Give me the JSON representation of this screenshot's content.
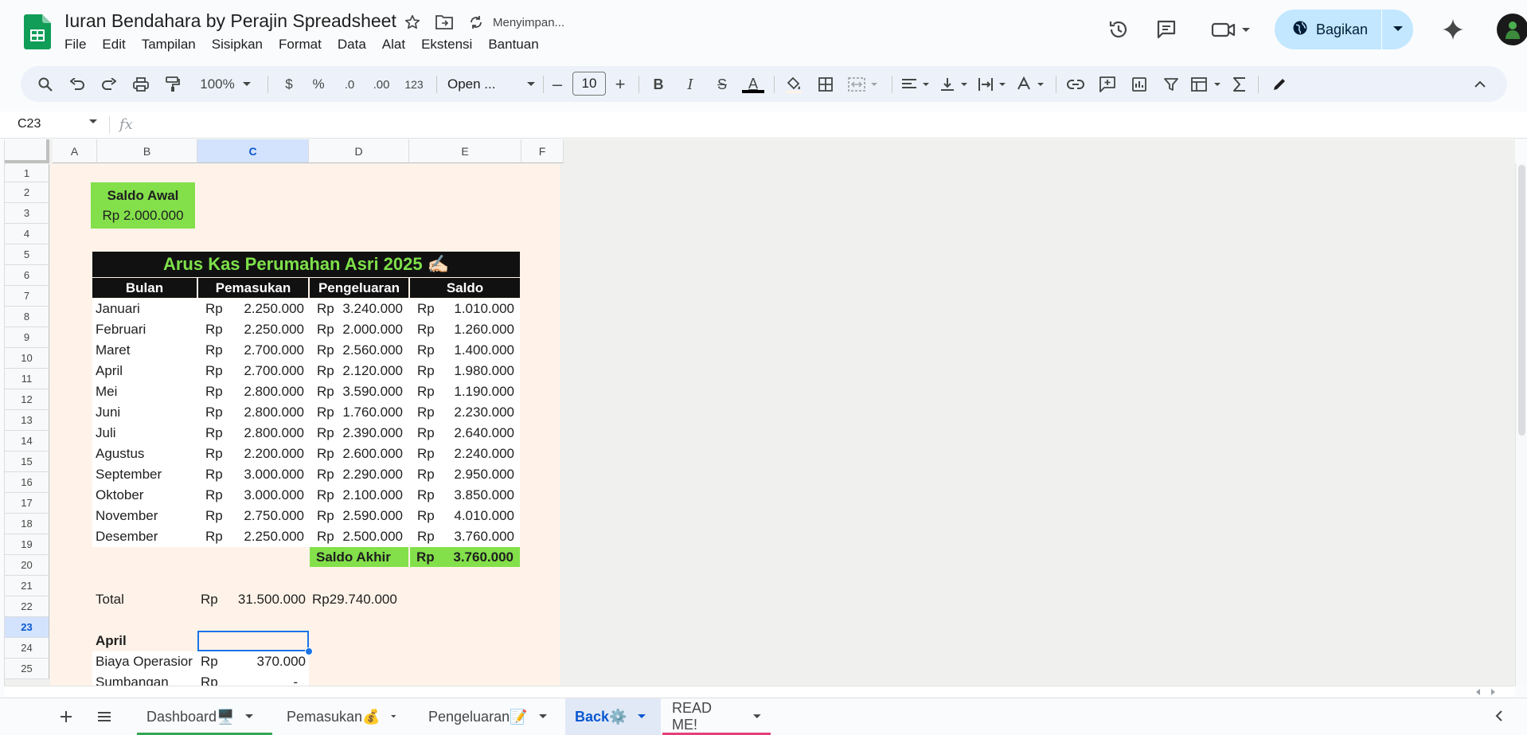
{
  "app": {
    "title": "Iuran Bendahara by Perajin Spreadsheet",
    "saving_status": "Menyimpan...",
    "menu": [
      "File",
      "Edit",
      "Tampilan",
      "Sisipkan",
      "Format",
      "Data",
      "Alat",
      "Ekstensi",
      "Bantuan"
    ],
    "share_label": "Bagikan"
  },
  "toolbar": {
    "zoom": "100%",
    "currency": "$",
    "percent": "%",
    "dec_decrease": ".0",
    "dec_increase": ".00",
    "number_format": "123",
    "font": "Open ...",
    "font_size": "10",
    "minus": "–",
    "plus": "+",
    "bold": "B",
    "italic": "I",
    "strike": "S",
    "text_color": "A"
  },
  "formula_bar": {
    "name_box": "C23",
    "fx": "fx"
  },
  "columns": [
    "A",
    "B",
    "C",
    "D",
    "E",
    "F"
  ],
  "rows": [
    "1",
    "2",
    "3",
    "4",
    "5",
    "6",
    "7",
    "8",
    "9",
    "10",
    "11",
    "12",
    "13",
    "14",
    "15",
    "16",
    "17",
    "18",
    "19",
    "20",
    "21",
    "22",
    "23",
    "24",
    "25"
  ],
  "sheet": {
    "saldo_awal_label": "Saldo Awal",
    "saldo_awal_value": "Rp  2.000.000",
    "table_title": "Arus Kas Perumahan Asri 2025",
    "table_title_emoji": "✍🏻",
    "headers": [
      "Bulan",
      "Pemasukan",
      "Pengeluaran",
      "Saldo"
    ],
    "currency": "Rp",
    "months": [
      {
        "bulan": "Januari",
        "masuk": "2.250.000",
        "keluar": "3.240.000",
        "saldo": "1.010.000"
      },
      {
        "bulan": "Februari",
        "masuk": "2.250.000",
        "keluar": "2.000.000",
        "saldo": "1.260.000"
      },
      {
        "bulan": "Maret",
        "masuk": "2.700.000",
        "keluar": "2.560.000",
        "saldo": "1.400.000"
      },
      {
        "bulan": "April",
        "masuk": "2.700.000",
        "keluar": "2.120.000",
        "saldo": "1.980.000"
      },
      {
        "bulan": "Mei",
        "masuk": "2.800.000",
        "keluar": "3.590.000",
        "saldo": "1.190.000"
      },
      {
        "bulan": "Juni",
        "masuk": "2.800.000",
        "keluar": "1.760.000",
        "saldo": "2.230.000"
      },
      {
        "bulan": "Juli",
        "masuk": "2.800.000",
        "keluar": "2.390.000",
        "saldo": "2.640.000"
      },
      {
        "bulan": "Agustus",
        "masuk": "2.200.000",
        "keluar": "2.600.000",
        "saldo": "2.240.000"
      },
      {
        "bulan": "September",
        "masuk": "3.000.000",
        "keluar": "2.290.000",
        "saldo": "2.950.000"
      },
      {
        "bulan": "Oktober",
        "masuk": "3.000.000",
        "keluar": "2.100.000",
        "saldo": "3.850.000"
      },
      {
        "bulan": "November",
        "masuk": "2.750.000",
        "keluar": "2.590.000",
        "saldo": "4.010.000"
      },
      {
        "bulan": "Desember",
        "masuk": "2.250.000",
        "keluar": "2.500.000",
        "saldo": "3.760.000"
      }
    ],
    "saldo_akhir_label": "Saldo Akhir",
    "saldo_akhir_rp": "Rp",
    "saldo_akhir_value": "3.760.000",
    "total_label": "Total",
    "total_masuk_rp": "Rp",
    "total_masuk": "31.500.000",
    "total_keluar": "Rp29.740.000",
    "april_label": "April",
    "row24_label": "Biaya Operasior",
    "row24_rp": "Rp",
    "row24_value": "370.000",
    "row25_label": "Sumbangan",
    "row25_rp": "Rp",
    "row25_value": "-"
  },
  "tabs": [
    {
      "label": "Dashboard",
      "emoji": "🖥️",
      "color": "#34a853"
    },
    {
      "label": "Pemasukan",
      "emoji": "💰",
      "color": ""
    },
    {
      "label": "Pengeluaran",
      "emoji": "📝",
      "color": ""
    },
    {
      "label": "Back",
      "emoji": "⚙️",
      "color": ""
    },
    {
      "label": "READ ME!",
      "emoji": "",
      "color": "#e5407a"
    }
  ],
  "colors": {
    "accent_green": "#83e04a",
    "title_green": "#7ee04a",
    "sheet_bg": "#fff3e9",
    "selection": "#1a73e8"
  }
}
